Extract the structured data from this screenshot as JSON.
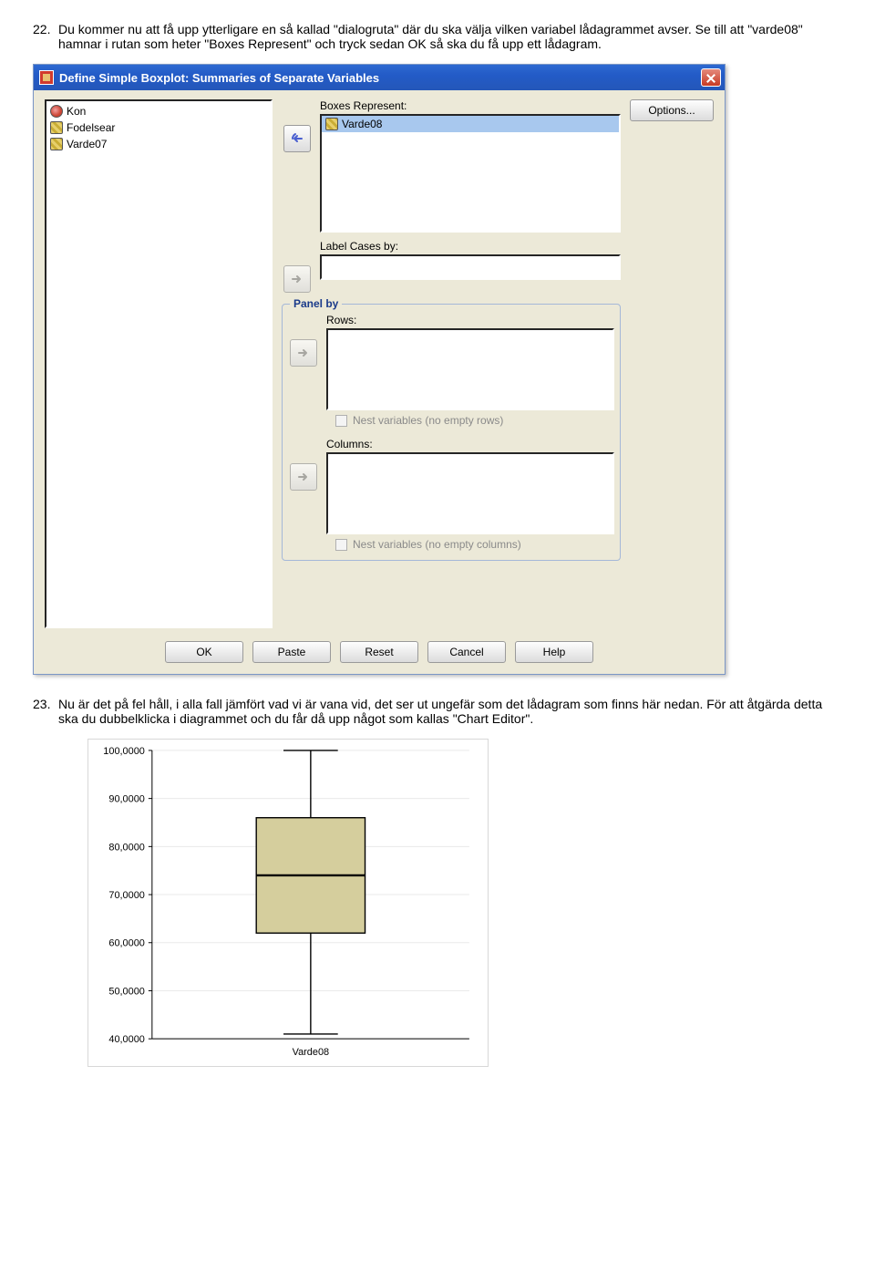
{
  "text": {
    "p22_num": "22.",
    "p22_body": "Du kommer nu att få upp ytterligare en så kallad \"dialogruta\" där du ska välja vilken variabel lådagrammet avser. Se till att \"varde08\" hamnar i rutan som heter \"Boxes Represent\" och tryck sedan OK så ska du få upp ett lådagram.",
    "p23_num": "23.",
    "p23_body": "Nu är det på fel håll, i alla fall jämfört vad vi är vana vid, det ser ut ungefär som det lådagram som finns här nedan. För att åtgärda detta ska du dubbelklicka i diagrammet och du får då upp något som kallas \"Chart Editor\"."
  },
  "dialog": {
    "title": "Define Simple Boxplot: Summaries of Separate Variables",
    "vars": [
      {
        "label": "Kon",
        "type": "nom"
      },
      {
        "label": "Fodelsear",
        "type": "scale"
      },
      {
        "label": "Varde07",
        "type": "scale"
      }
    ],
    "boxes_label": "Boxes Represent:",
    "boxes_item": "Varde08",
    "labelcases_label": "Label Cases by:",
    "panel_legend": "Panel by",
    "rows_label": "Rows:",
    "cols_label": "Columns:",
    "nest_rows": "Nest variables (no empty rows)",
    "nest_cols": "Nest variables (no empty columns)",
    "options_label": "Options...",
    "ok": "OK",
    "paste": "Paste",
    "reset": "Reset",
    "cancel": "Cancel",
    "help": "Help",
    "underline": {
      "boxes": "B",
      "labelcases": "C",
      "rows": "w",
      "cols": "u",
      "nest_rows": "e",
      "nest_cols": "i",
      "options": "O",
      "paste": "P",
      "reset": "R"
    }
  },
  "chart_data": {
    "type": "boxplot",
    "xlabel": "Varde08",
    "ylabel": "",
    "ylim": [
      40,
      100
    ],
    "yticks": [
      40,
      50,
      60,
      70,
      80,
      90,
      100
    ],
    "ytick_labels": [
      "40,0000",
      "50,0000",
      "60,0000",
      "70,0000",
      "80,0000",
      "90,0000",
      "100,0000"
    ],
    "series": [
      {
        "name": "Varde08",
        "min": 41,
        "q1": 62,
        "median": 74,
        "q3": 86,
        "max": 100
      }
    ]
  }
}
